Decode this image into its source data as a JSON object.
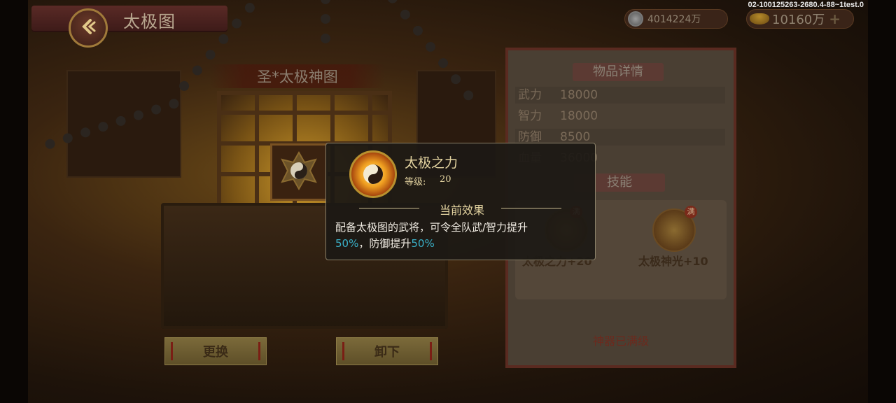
{
  "header": {
    "title": "太极图",
    "silver_amount": "4014224万",
    "gold_amount": "10160万",
    "debug_build": "02-100125263-2680.4-88~1test.0"
  },
  "artifact": {
    "name": "圣*太极神图",
    "buttons": {
      "replace": "更换",
      "unequip": "卸下"
    }
  },
  "details_panel": {
    "title": "物品详情",
    "stats": [
      {
        "label": "武力",
        "value": "18000"
      },
      {
        "label": "智力",
        "value": "18000"
      },
      {
        "label": "防御",
        "value": "8500"
      },
      {
        "label": "血量",
        "value": "36000"
      }
    ],
    "skills_title": "技能",
    "skills": [
      {
        "name": "太极之力+20",
        "badge": "满"
      },
      {
        "name": "太极神光+10",
        "badge": "满"
      }
    ],
    "max_level_text": "神器已满级"
  },
  "popup": {
    "skill_name": "太极之力",
    "level_label": "等级:",
    "level_value": "20",
    "effect_heading": "当前效果",
    "effect_text_1": "配备太极图的武将，可令全队武/智力提升",
    "effect_pct_1": "50%",
    "effect_text_2": "，防御提升",
    "effect_pct_2": "50%"
  },
  "icons": {
    "back": "back-arrow-icon",
    "silver": "silver-coin-icon",
    "gold": "gold-ingot-icon",
    "add": "plus-icon",
    "artifact": "taiji-icon"
  },
  "colors": {
    "highlight": "#3ab0c8",
    "popup_title": "#e3d3a0",
    "panel_red": "#6b2a1e"
  }
}
